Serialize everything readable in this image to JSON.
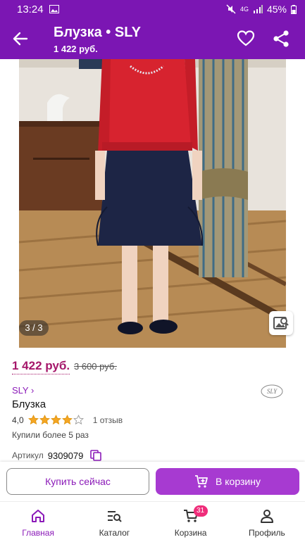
{
  "status_bar": {
    "time": "13:24",
    "battery": "45%",
    "network": "4G"
  },
  "header": {
    "title": "Блузка • SLY",
    "subtitle": "1 422 руб."
  },
  "gallery": {
    "counter": "3 / 3"
  },
  "product": {
    "price": "1 422 руб.",
    "old_price": "3 600 руб.",
    "brand": "SLY ›",
    "name": "Блузка",
    "rating_value": "4,0",
    "rating_stars": 4,
    "reviews": "1 отзыв",
    "bought": "Купили более 5 раз",
    "article_label": "Артикул",
    "article_value": "9309079"
  },
  "actions": {
    "buy_now": "Купить сейчас",
    "to_cart": "В корзину"
  },
  "nav": {
    "items": [
      {
        "label": "Главная",
        "icon": "home-icon",
        "active": true
      },
      {
        "label": "Каталог",
        "icon": "catalog-icon",
        "active": false
      },
      {
        "label": "Корзина",
        "icon": "cart-icon",
        "active": false
      },
      {
        "label": "Профиль",
        "icon": "profile-icon",
        "active": false
      }
    ],
    "cart_badge": "31"
  },
  "colors": {
    "brand_purple": "#7b16b3",
    "price_color": "#a5176a",
    "cart_button": "#a73ad1",
    "badge": "#ef2d7a"
  }
}
